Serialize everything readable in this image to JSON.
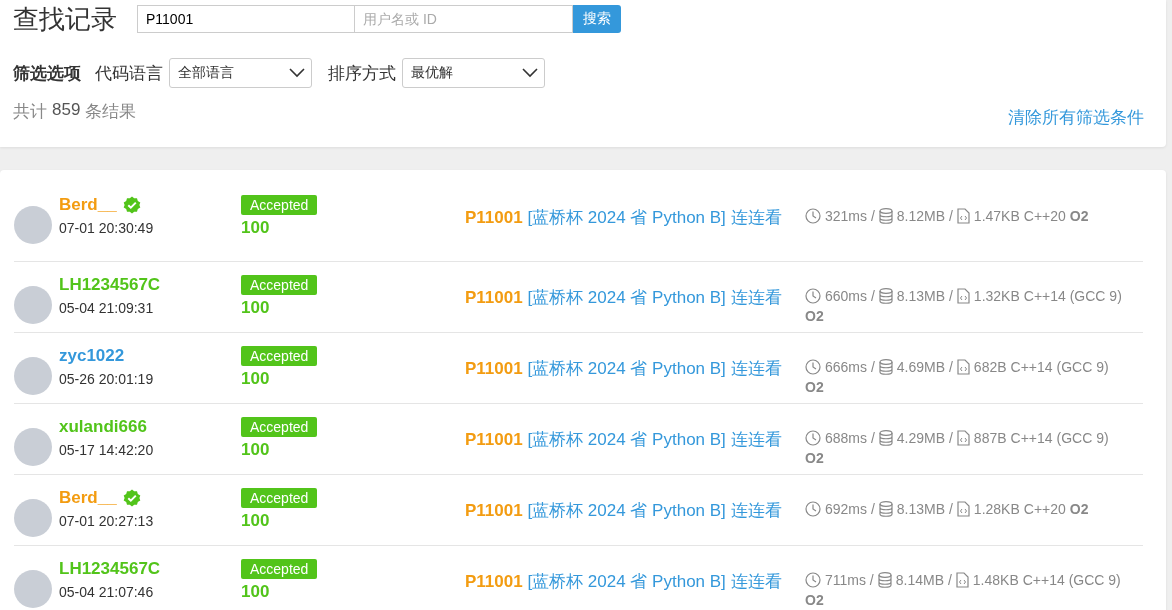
{
  "header": {
    "title": "查找记录",
    "search": {
      "problem_value": "P11001",
      "user_placeholder": "用户名或 ID",
      "button": "搜索"
    }
  },
  "filters": {
    "label": "筛选选项",
    "groups": [
      {
        "label": "代码语言",
        "value": "全部语言"
      },
      {
        "label": "排序方式",
        "value": "最优解"
      }
    ],
    "count_prefix": "共计",
    "count": "859",
    "count_suffix": "条结果",
    "clear_link": "清除所有筛选条件"
  },
  "records": [
    {
      "user": {
        "name": "Berd__",
        "color": "#f39c11",
        "verified": true
      },
      "time": "07-01 20:30:49",
      "status": "Accepted",
      "score": "100",
      "problem_id": "P11001",
      "problem_title": "[蓝桥杯 2024 省 Python B] 连连看",
      "time_used": "321ms /",
      "memory": "8.12MB /",
      "code_size": "1.47KB",
      "language": "C++20",
      "o2": "O2"
    },
    {
      "user": {
        "name": "LH1234567C",
        "color": "#52c41a",
        "verified": false
      },
      "time": "05-04 21:09:31",
      "status": "Accepted",
      "score": "100",
      "problem_id": "P11001",
      "problem_title": "[蓝桥杯 2024 省 Python B] 连连看",
      "time_used": "660ms /",
      "memory": "8.13MB /",
      "code_size": "1.32KB",
      "language": "C++14 (GCC 9)",
      "o2": "O2"
    },
    {
      "user": {
        "name": "zyc1022",
        "color": "#3498db",
        "verified": false
      },
      "time": "05-26 20:01:19",
      "status": "Accepted",
      "score": "100",
      "problem_id": "P11001",
      "problem_title": "[蓝桥杯 2024 省 Python B] 连连看",
      "time_used": "666ms /",
      "memory": "4.69MB /",
      "code_size": "682B",
      "language": "C++14 (GCC 9)",
      "o2": "O2"
    },
    {
      "user": {
        "name": "xulandi666",
        "color": "#52c41a",
        "verified": false
      },
      "time": "05-17 14:42:20",
      "status": "Accepted",
      "score": "100",
      "problem_id": "P11001",
      "problem_title": "[蓝桥杯 2024 省 Python B] 连连看",
      "time_used": "688ms /",
      "memory": "4.29MB /",
      "code_size": "887B",
      "language": "C++14 (GCC 9)",
      "o2": "O2"
    },
    {
      "user": {
        "name": "Berd__",
        "color": "#f39c11",
        "verified": true
      },
      "time": "07-01 20:27:13",
      "status": "Accepted",
      "score": "100",
      "problem_id": "P11001",
      "problem_title": "[蓝桥杯 2024 省 Python B] 连连看",
      "time_used": "692ms /",
      "memory": "8.13MB /",
      "code_size": "1.28KB",
      "language": "C++20",
      "o2": "O2"
    },
    {
      "user": {
        "name": "LH1234567C",
        "color": "#52c41a",
        "verified": false
      },
      "time": "05-04 21:07:46",
      "status": "Accepted",
      "score": "100",
      "problem_id": "P11001",
      "problem_title": "[蓝桥杯 2024 省 Python B] 连连看",
      "time_used": "711ms /",
      "memory": "8.14MB /",
      "code_size": "1.48KB",
      "language": "C++14 (GCC 9)",
      "o2": "O2"
    }
  ]
}
